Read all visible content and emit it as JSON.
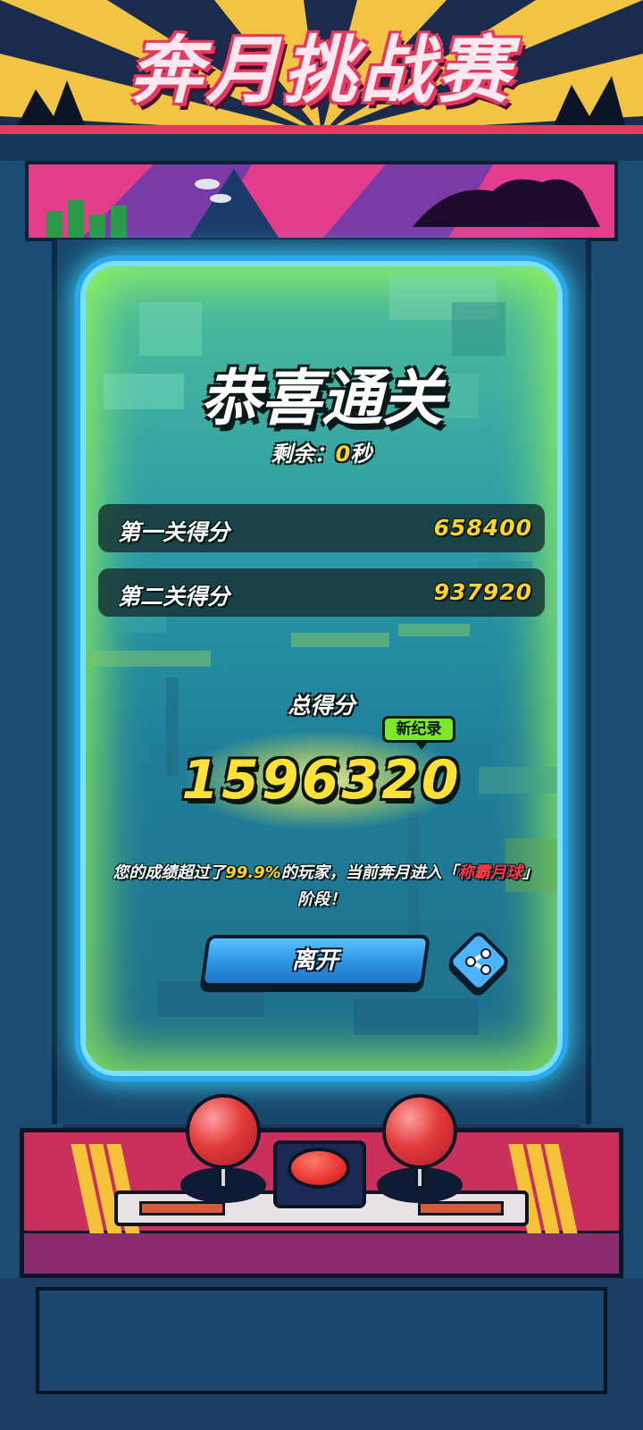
{
  "banner": {
    "title": "奔月挑战赛"
  },
  "result": {
    "title": "恭喜通关",
    "remaining_label": "剩余：",
    "remaining_value": "0",
    "remaining_unit": "秒"
  },
  "scores": [
    {
      "label": "第一关得分",
      "value": "658400"
    },
    {
      "label": "第二关得分",
      "value": "937920"
    }
  ],
  "total": {
    "label": "总得分",
    "value": "1596320",
    "badge": "新纪录"
  },
  "rank": {
    "prefix": "您的成绩超过了",
    "percent": "99.9%",
    "middle": "的玩家，当前奔月进入「",
    "tier": "称霸月球",
    "suffix": "」阶段！"
  },
  "actions": {
    "leave_label": "离开",
    "share_icon": "share-icon"
  },
  "colors": {
    "accent_yellow": "#ffd42a",
    "accent_red": "#ff3b4a",
    "badge_green": "#7be82a",
    "button_blue": "#2a8fe0",
    "screen_glow": "#37d7ff"
  }
}
